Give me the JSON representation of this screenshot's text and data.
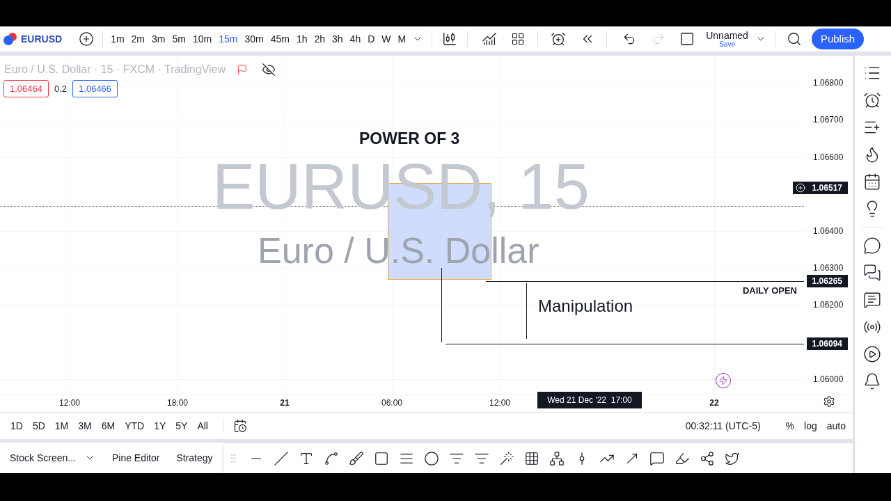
{
  "symbol": {
    "ticker": "EURUSD"
  },
  "intervals": [
    {
      "label": "1m",
      "selected": false
    },
    {
      "label": "2m",
      "selected": false
    },
    {
      "label": "3m",
      "selected": false
    },
    {
      "label": "5m",
      "selected": false
    },
    {
      "label": "10m",
      "selected": false
    },
    {
      "label": "15m",
      "selected": true
    },
    {
      "label": "30m",
      "selected": false
    },
    {
      "label": "45m",
      "selected": false
    },
    {
      "label": "1h",
      "selected": false
    },
    {
      "label": "2h",
      "selected": false
    },
    {
      "label": "3h",
      "selected": false
    },
    {
      "label": "4h",
      "selected": false
    },
    {
      "label": "D",
      "selected": false
    },
    {
      "label": "W",
      "selected": false
    },
    {
      "label": "M",
      "selected": false
    }
  ],
  "toolbar": {
    "layout_name": "Unnamed",
    "save_label": "Save",
    "publish": "Publish",
    "redo_disabled": true
  },
  "chart": {
    "legend_title": "Euro / U.S. Dollar · 15 · FXCM · TradingView",
    "bid": "1.06464",
    "spread": "0.2",
    "ask": "1.06466",
    "watermark_symbol": "EURUSD, 15",
    "watermark_name": "Euro / U.S. Dollar",
    "annotations": [
      {
        "kind": "heading",
        "text": "POWER OF 3"
      },
      {
        "kind": "label",
        "text": "Manipulation"
      },
      {
        "kind": "line-label",
        "text": "DAILY OPEN"
      }
    ],
    "price_ticks": [
      "1.06800",
      "1.06700",
      "1.06600",
      "1.06400",
      "1.06300",
      "1.06200",
      "1.06000"
    ],
    "price_tags": [
      {
        "kind": "crosshair",
        "text": "1.06517"
      },
      {
        "kind": "line",
        "text": "1.06265"
      },
      {
        "kind": "line",
        "text": "1.06094"
      }
    ],
    "time_ticks": [
      {
        "kind": "time",
        "text": "12:00"
      },
      {
        "kind": "time",
        "text": "18:00"
      },
      {
        "kind": "day",
        "text": "21"
      },
      {
        "kind": "time",
        "text": "06:00"
      },
      {
        "kind": "time",
        "text": "12:00"
      },
      {
        "kind": "day",
        "text": "22"
      }
    ],
    "crosshair_time": "Wed 21 Dec '22  17:00"
  },
  "ranges": [
    "1D",
    "5D",
    "1M",
    "3M",
    "6M",
    "YTD",
    "1Y",
    "5Y",
    "All"
  ],
  "clock": "00:32:11 (UTC-5)",
  "scale_options": [
    "%",
    "log",
    "auto"
  ],
  "bottom_tabs": [
    {
      "label": "Stock Screen...",
      "dropdown": true
    },
    {
      "label": "Pine Editor",
      "dropdown": false
    },
    {
      "label": "Strategy",
      "dropdown": false
    }
  ]
}
